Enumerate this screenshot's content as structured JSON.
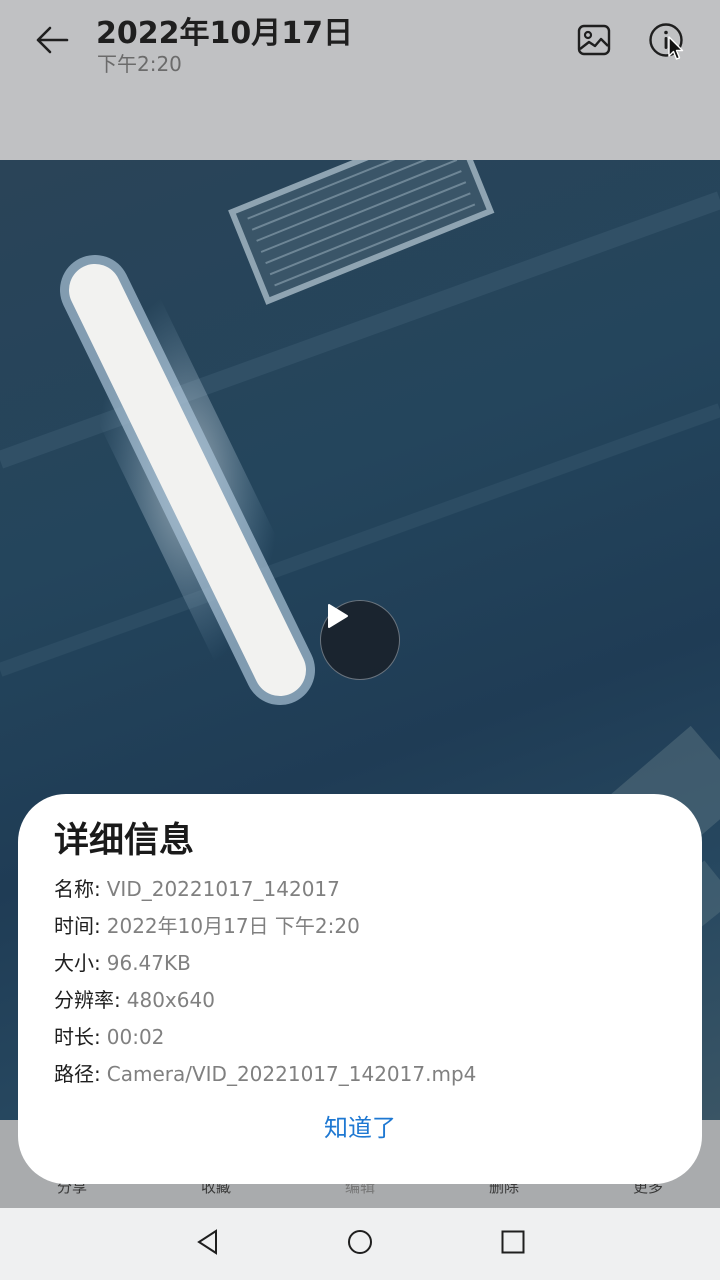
{
  "header": {
    "title": "2022年10月17日",
    "subtitle": "下午2:20",
    "icons": [
      "back-arrow-icon",
      "gallery-icon",
      "info-icon"
    ]
  },
  "media": {
    "type": "video",
    "play_icon": "play-icon"
  },
  "toolbar": {
    "items": [
      {
        "label": "分享"
      },
      {
        "label": "收藏"
      },
      {
        "label": "编辑"
      },
      {
        "label": "删除"
      },
      {
        "label": "更多"
      }
    ]
  },
  "dialog": {
    "title": "详细信息",
    "rows": [
      {
        "key": "名称:",
        "value": "VID_20221017_142017"
      },
      {
        "key": "时间:",
        "value": "2022年10月17日 下午2:20"
      },
      {
        "key": "大小:",
        "value": "96.47KB"
      },
      {
        "key": "分辨率:",
        "value": "480x640"
      },
      {
        "key": "时长:",
        "value": "00:02"
      },
      {
        "key": "路径:",
        "value": "Camera/VID_20221017_142017.mp4"
      }
    ],
    "confirm_label": "知道了",
    "accent": "#1e78d2"
  },
  "navbar": {
    "icons": [
      "nav-back-icon",
      "nav-home-icon",
      "nav-recents-icon"
    ]
  }
}
